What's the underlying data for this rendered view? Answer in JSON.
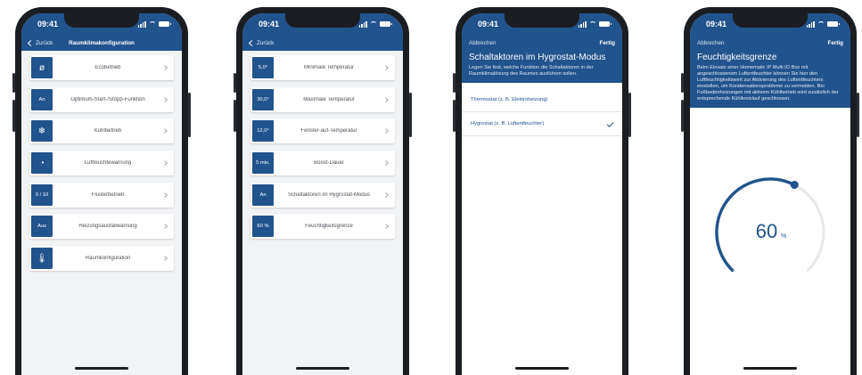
{
  "status": {
    "time": "09:41"
  },
  "screen1": {
    "back": "Zurück",
    "title": "Raumklimakonfiguration",
    "items": [
      {
        "tag": "ø",
        "icon": "ecomode-icon",
        "label": "Ecobetrieb"
      },
      {
        "tag": "An",
        "label": "Optimum-Start-/Stopp-Funktion"
      },
      {
        "tag": "❄",
        "icon": "snowflake-icon",
        "label": "Kühlbetrieb"
      },
      {
        "tag": "◔",
        "icon": "humidity-icon",
        "label": "Luftfeuchtewarnung"
      },
      {
        "tag": "0 / 10",
        "label": "Flüsterbetrieb"
      },
      {
        "tag": "Aus",
        "label": "Heizungsausfallwarnung"
      },
      {
        "tag": "🌡",
        "icon": "thermometer-icon",
        "label": "Raumkonfiguration"
      }
    ]
  },
  "screen2": {
    "back": "Zurück",
    "items": [
      {
        "tag": "5,0°",
        "label": "Minimale Temperatur"
      },
      {
        "tag": "30,0°",
        "label": "Maximale Temperatur"
      },
      {
        "tag": "12,0°",
        "label": "Fenster-auf-Temperatur"
      },
      {
        "tag": "5 min.",
        "label": "Boost-Dauer"
      },
      {
        "tag": "An",
        "label": "Schaltaktoren im Hygrostat-Modus"
      },
      {
        "tag": "60 %",
        "label": "Feuchtigkeitsgrenze"
      }
    ]
  },
  "screen3": {
    "cancel": "Abbrechen",
    "done": "Fertig",
    "heading": "Schaltaktoren im Hygrostat-Modus",
    "description": "Legen Sie fest, welche Funktion die Schaltaktoren in der Raumklimalösung des Raumes ausführen sollen.",
    "options": [
      {
        "label": "Thermostat (z. B. Elektroheizung)",
        "selected": false
      },
      {
        "label": "Hygrostat (z. B. Luftentfeuchter)",
        "selected": true
      }
    ]
  },
  "screen4": {
    "cancel": "Abbrechen",
    "done": "Fertig",
    "heading": "Feuchtigkeitsgrenze",
    "description": "Beim Einsatz einer Homematic IP Multi IO Box mit angeschlossenem Luftentfeuchter können Sie hier den Luftfeuchtigkeitswert zur Aktivierung des Luftentfeuchters einstellen, um Kondensationsprobleme zu vermeiden. Bei Fußbodenheizungen mit aktivem Kühlbetrieb wird zusätzlich der entsprechende Kühlkreislauf geschlossen.",
    "gauge_value": "60",
    "gauge_unit": "%",
    "gauge_fraction": 0.6
  },
  "colors": {
    "accent": "#21538c",
    "background": "#f2f3f5",
    "text": "#4a5058"
  }
}
